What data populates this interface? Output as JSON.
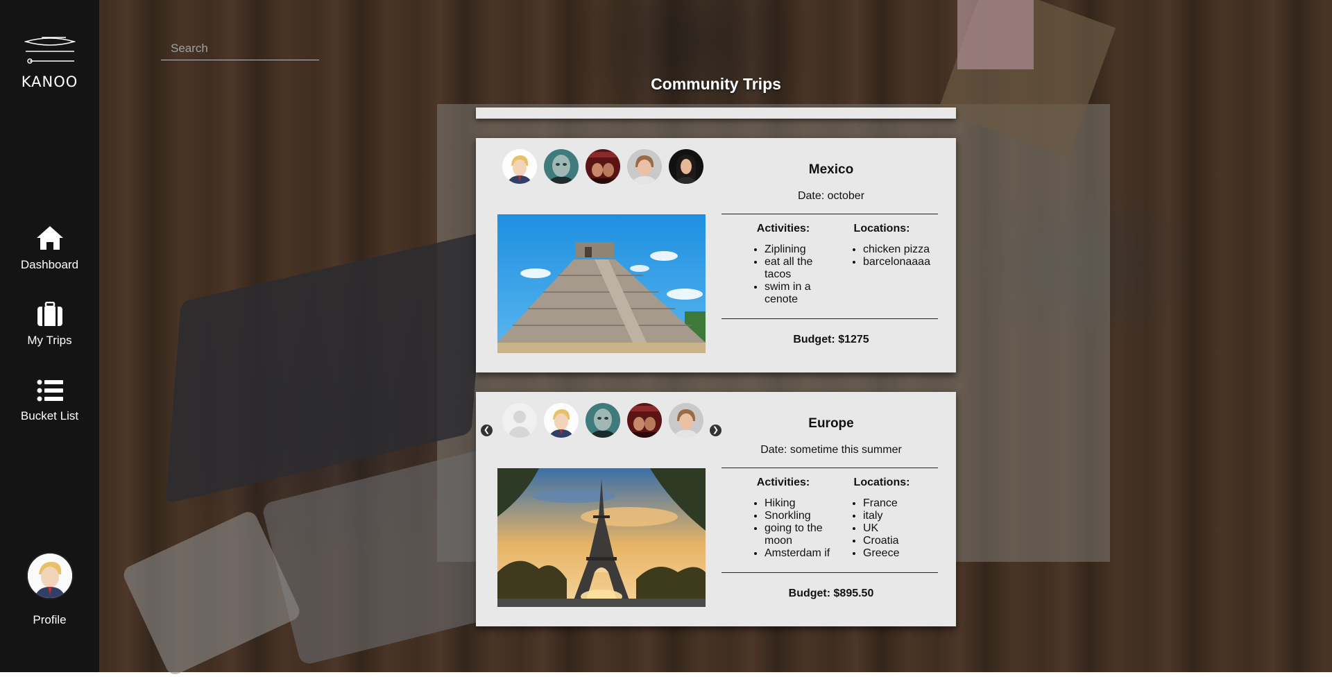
{
  "app": {
    "brand": "KANOO"
  },
  "sidebar": {
    "items": [
      {
        "label": "Dashboard",
        "icon": "home-icon"
      },
      {
        "label": "My Trips",
        "icon": "suitcase-icon"
      },
      {
        "label": "Bucket List",
        "icon": "list-icon"
      }
    ],
    "profile_label": "Profile"
  },
  "search": {
    "placeholder": "Search"
  },
  "page": {
    "title": "Community Trips"
  },
  "trips": [
    {
      "name": "Mexico",
      "date": "Date: october",
      "activities_title": "Activities:",
      "locations_title": "Locations:",
      "activities": [
        "Ziplining",
        "eat all the tacos",
        "swim in a cenote"
      ],
      "locations": [
        "chicken pizza",
        "barcelonaaaa"
      ],
      "budget": "Budget: $1275"
    },
    {
      "name": "Europe",
      "date": "Date: sometime this summer",
      "activities_title": "Activities:",
      "locations_title": "Locations:",
      "activities": [
        "Hiking",
        "Snorkling",
        "going to the moon",
        "Amsterdam if"
      ],
      "locations": [
        "France",
        "italy",
        "UK",
        "Croatia",
        "Greece"
      ],
      "budget": "Budget: $895.50"
    }
  ],
  "colors": {
    "sidebar": "#141414",
    "card": "#e8e8e8"
  }
}
